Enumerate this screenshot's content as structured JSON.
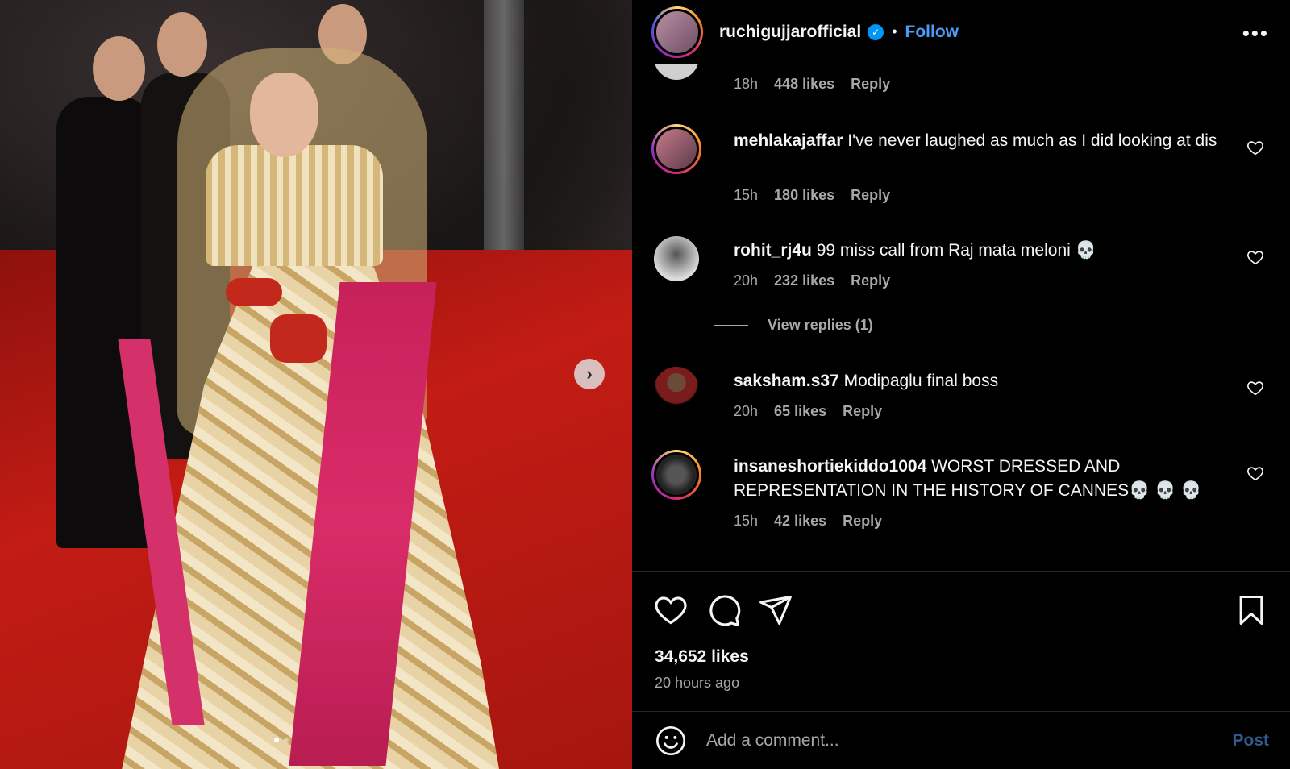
{
  "header": {
    "username": "ruchigujjarofficial",
    "separator": "•",
    "follow_label": "Follow",
    "more_label": "•••"
  },
  "carousel": {
    "next_label": "›"
  },
  "comments": [
    {
      "username": "",
      "text": "",
      "time": "18h",
      "likes": "448 likes",
      "reply": "Reply"
    },
    {
      "username": "mehlakajaffar",
      "text": "I've never laughed as much as I did looking at dis",
      "time": "15h",
      "likes": "180 likes",
      "reply": "Reply"
    },
    {
      "username": "rohit_rj4u",
      "text": "99 miss call from Raj mata meloni 💀",
      "time": "20h",
      "likes": "232 likes",
      "reply": "Reply"
    },
    {
      "username": "saksham.s37",
      "text": "Modipaglu final boss",
      "time": "20h",
      "likes": "65 likes",
      "reply": "Reply"
    },
    {
      "username": "insaneshortiekiddo1004",
      "text": "WORST DRESSED AND REPRESENTATION IN THE HISTORY OF CANNES💀 💀 💀",
      "time": "15h",
      "likes": "42 likes",
      "reply": "Reply"
    }
  ],
  "view_replies": "View replies (1)",
  "post": {
    "likes": "34,652 likes",
    "time_ago": "20 hours ago"
  },
  "add_comment": {
    "placeholder": "Add a comment...",
    "post_label": "Post"
  },
  "colors": {
    "follow": "#4a9cf6",
    "verified": "#0095f6",
    "secondary_text": "#a8a8a8",
    "post_disabled": "#2d5c8f"
  },
  "icons": [
    "heart-icon",
    "comment-icon",
    "share-icon",
    "bookmark-icon",
    "emoji-icon",
    "verified-icon",
    "more-icon",
    "chevron-right-icon"
  ]
}
